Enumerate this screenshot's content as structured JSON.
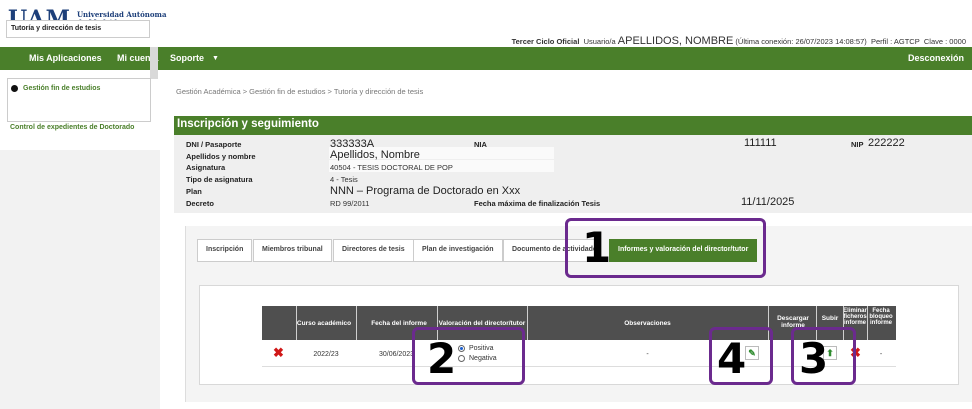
{
  "header": {
    "logo": "UAM",
    "uni_line1": "Universidad Autónoma",
    "uni_line2": "de Madrid",
    "app_name": "Tercer Ciclo Oficial",
    "user_prefix": "Usuario/a",
    "user_name": "APELLIDOS, NOMBRE",
    "last_login": "(Última conexión: 26/07/2023 14:08:57)",
    "profile": "Perfil : AGTCP",
    "key": "Clave : 0000"
  },
  "menu": {
    "apps": "Mis Aplicaciones",
    "account": "Mi cuenta",
    "support": "Soporte",
    "support_arrow": "▼",
    "logout": "Desconexión"
  },
  "sidebar": {
    "section": "Gestión fin de estudios",
    "item1": "Tutoría y dirección de tesis",
    "item2": "Control de expedientes de Doctorado"
  },
  "breadcrumb": "Gestión Académica > Gestión fin de estudios > Tutoría y dirección de tesis",
  "section_title": "Inscripción y seguimiento",
  "info": {
    "dni_label": "DNI / Pasaporte",
    "dni_value": "333333A",
    "nia_label": "NIA",
    "nia_value": "111111",
    "nip_label": "NIP",
    "nip_value": "222222",
    "name_label": "Apellidos y nombre",
    "name_value": "Apellidos, Nombre",
    "subject_label": "Asignatura",
    "subject_value": "40504 - TESIS DOCTORAL DE POP",
    "type_label": "Tipo de asignatura",
    "type_value": "4 - Tesis",
    "plan_label": "Plan",
    "plan_value": "NNN – Programa de Doctorado en Xxx",
    "decree_label": "Decreto",
    "decree_value": "RD 99/2011",
    "deadline_label": "Fecha máxima de finalización Tesis",
    "deadline_value": "11/11/2025"
  },
  "tabs": [
    {
      "label": "Inscripción"
    },
    {
      "label": "Miembros tribunal"
    },
    {
      "label": "Directores de tesis"
    },
    {
      "label": "Plan de investigación"
    },
    {
      "label": "Documento de actividades"
    },
    {
      "label": "Informes y valoración del director/tutor"
    }
  ],
  "table": {
    "headers": {
      "year": "Curso académico",
      "date": "Fecha del informe",
      "rating": "Valoración del director/tutor",
      "notes": "Observaciones",
      "download": "Descargar informe",
      "upload": "Subir",
      "delete": "Eliminar ficheros informe",
      "lock": "Fecha bloqueo informe"
    },
    "row": {
      "year": "2022/23",
      "date": "30/06/2023",
      "opt_pos": "Positiva",
      "opt_neg": "Negativa",
      "notes": "-",
      "lock": "-"
    }
  },
  "callouts": {
    "c1": "1",
    "c2": "2",
    "c3": "3",
    "c4": "4"
  },
  "colors": {
    "brand_green": "#4a7f2a",
    "callout_purple": "#6b2a8e",
    "delete_red": "#d01818"
  }
}
